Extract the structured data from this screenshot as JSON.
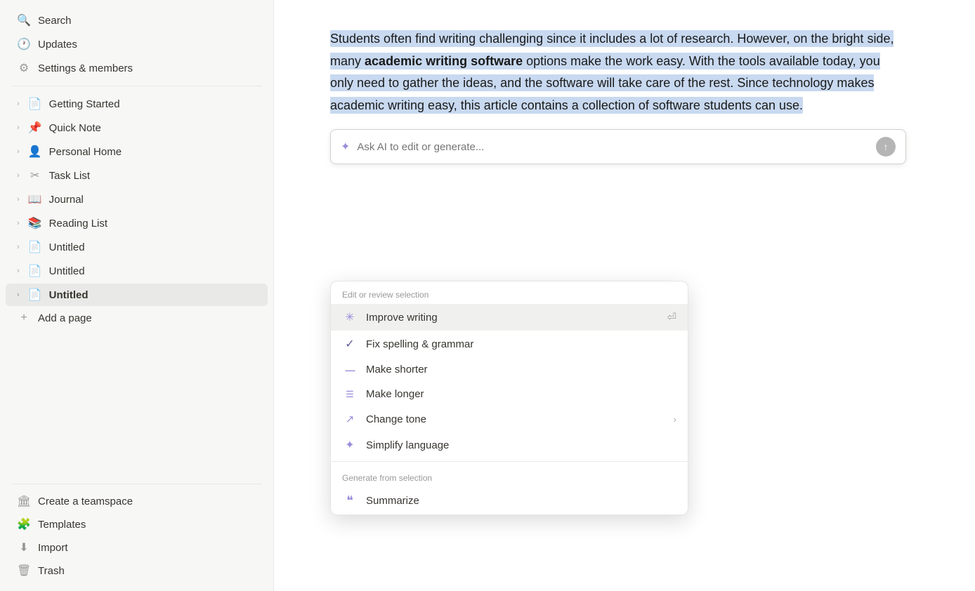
{
  "sidebar": {
    "search_label": "Search",
    "updates_label": "Updates",
    "settings_label": "Settings & members",
    "nav_items": [
      {
        "id": "getting-started",
        "label": "Getting Started",
        "icon": "doc",
        "has_chevron": true
      },
      {
        "id": "quick-note",
        "label": "Quick Note",
        "icon": "pin",
        "has_chevron": true
      },
      {
        "id": "personal-home",
        "label": "Personal Home",
        "icon": "person",
        "has_chevron": true
      },
      {
        "id": "task-list",
        "label": "Task List",
        "icon": "scissors",
        "has_chevron": true
      },
      {
        "id": "journal",
        "label": "Journal",
        "icon": "book",
        "has_chevron": true
      },
      {
        "id": "reading-list",
        "label": "Reading List",
        "icon": "doc-filled",
        "has_chevron": true
      },
      {
        "id": "untitled-1",
        "label": "Untitled",
        "icon": "doc",
        "has_chevron": true
      },
      {
        "id": "untitled-2",
        "label": "Untitled",
        "icon": "doc",
        "has_chevron": true
      },
      {
        "id": "untitled-3",
        "label": "Untitled",
        "icon": "doc",
        "has_chevron": true,
        "active": true
      }
    ],
    "add_page_label": "Add a page",
    "create_teamspace_label": "Create a teamspace",
    "templates_label": "Templates",
    "import_label": "Import",
    "trash_label": "Trash"
  },
  "editor": {
    "selected_text_parts": [
      {
        "text": "Students often find writing challenging since it includes a lot of research. However, on the bright side, many ",
        "bold": false
      },
      {
        "text": "academic writing software",
        "bold": true
      },
      {
        "text": " options make the work easy. With the tools available today, you only need to gather the ideas, and the software will take care of the rest. Since technology makes academic writing easy, this article contains a collection of software students can use.",
        "bold": false
      }
    ]
  },
  "ai_prompt": {
    "placeholder": "Ask AI to edit or generate...",
    "sparkle_icon": "✦",
    "send_icon": "↑"
  },
  "ai_menu": {
    "edit_section_label": "Edit or review selection",
    "generate_section_label": "Generate from selection",
    "items": [
      {
        "id": "improve-writing",
        "label": "Improve writing",
        "icon": "sparkle",
        "icon_char": "✳",
        "hint": "⏎",
        "has_chevron": false,
        "highlighted": true
      },
      {
        "id": "fix-spelling",
        "label": "Fix spelling & grammar",
        "icon": "check",
        "icon_char": "✓",
        "hint": "",
        "has_chevron": false,
        "highlighted": false
      },
      {
        "id": "make-shorter",
        "label": "Make shorter",
        "icon": "lines-short",
        "icon_char": "≡",
        "hint": "",
        "has_chevron": false,
        "highlighted": false
      },
      {
        "id": "make-longer",
        "label": "Make longer",
        "icon": "lines-long",
        "icon_char": "☰",
        "hint": "",
        "has_chevron": false,
        "highlighted": false
      },
      {
        "id": "change-tone",
        "label": "Change tone",
        "icon": "edit",
        "icon_char": "↗",
        "hint": "",
        "has_chevron": true,
        "highlighted": false
      },
      {
        "id": "simplify-language",
        "label": "Simplify language",
        "icon": "sparkle4",
        "icon_char": "✦",
        "hint": "",
        "has_chevron": false,
        "highlighted": false
      }
    ],
    "generate_items": [
      {
        "id": "summarize",
        "label": "Summarize",
        "icon": "quote",
        "icon_char": "❝",
        "hint": "",
        "has_chevron": false,
        "highlighted": false
      }
    ]
  }
}
